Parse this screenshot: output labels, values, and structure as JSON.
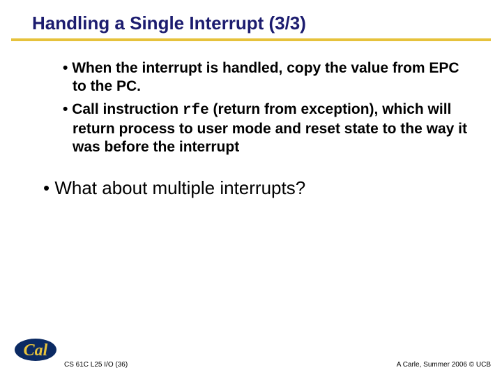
{
  "title": "Handling a Single Interrupt (3/3)",
  "bullets": {
    "b1": "When the interrupt is handled, copy the value from EPC to the PC.",
    "b2_pre": "Call instruction ",
    "b2_code": "rfe",
    "b2_post": " (return from exception), which will return process to user mode and reset state to the way it was before the interrupt"
  },
  "big_bullet": "What about multiple interrupts?",
  "footer": {
    "left": "CS 61C L25 I/O (36)",
    "right": "A Carle, Summer 2006 © UCB"
  }
}
